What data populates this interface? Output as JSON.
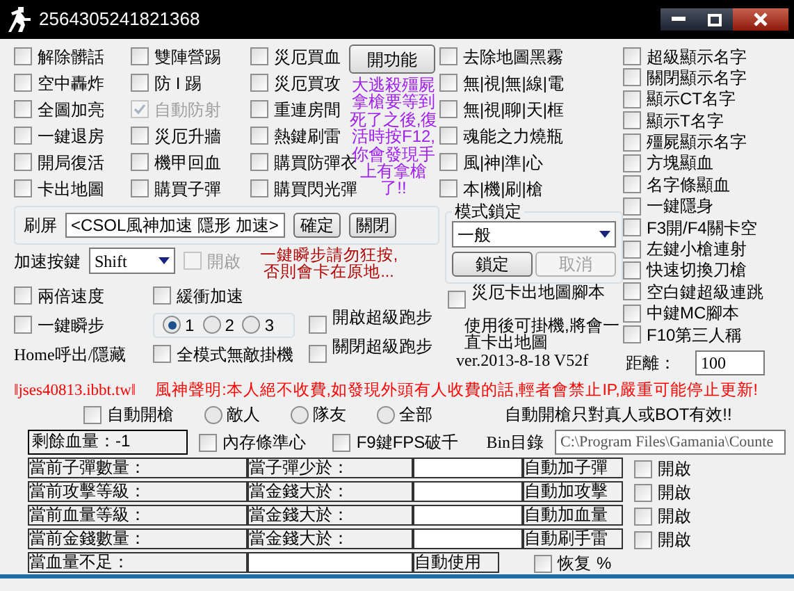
{
  "window": {
    "title": "2564305241821368"
  },
  "feature_columns": [
    [
      {
        "label": "解除髒話",
        "checked": false,
        "disabled": false
      },
      {
        "label": "空中轟炸",
        "checked": false,
        "disabled": false
      },
      {
        "label": "全圖加亮",
        "checked": false,
        "disabled": false
      },
      {
        "label": "一鍵退房",
        "checked": false,
        "disabled": false
      },
      {
        "label": "開局復活",
        "checked": false,
        "disabled": false
      },
      {
        "label": "卡出地圖",
        "checked": false,
        "disabled": false
      }
    ],
    [
      {
        "label": "雙陣營踢",
        "checked": false,
        "disabled": false
      },
      {
        "label": "防 I 踢",
        "checked": false,
        "disabled": false
      },
      {
        "label": "自動防射",
        "checked": true,
        "disabled": true
      },
      {
        "label": "災厄升牆",
        "checked": false,
        "disabled": false
      },
      {
        "label": "機甲回血",
        "checked": false,
        "disabled": false
      },
      {
        "label": "購買子彈",
        "checked": false,
        "disabled": false
      }
    ],
    [
      {
        "label": "災厄買血",
        "checked": false,
        "disabled": false
      },
      {
        "label": "災厄買攻",
        "checked": false,
        "disabled": false
      },
      {
        "label": "重連房間",
        "checked": false,
        "disabled": false
      },
      {
        "label": "熱鍵刷雷",
        "checked": false,
        "disabled": false
      },
      {
        "label": "購買防彈衣",
        "checked": false,
        "disabled": false
      },
      {
        "label": "購買閃光彈",
        "checked": false,
        "disabled": false
      }
    ]
  ],
  "function_button": "開功能",
  "zombie_note": "大逃殺殭屍拿槍要等到死了之後,復活時按F12,你會發現手上有拿槍了!!",
  "map_checks": [
    {
      "label": "去除地圖黑霧",
      "checked": false
    },
    {
      "label": "無|視|無|線|電",
      "checked": false
    },
    {
      "label": "無|視|聊|天|框",
      "checked": false
    },
    {
      "label": "魂能之力燒瓶",
      "checked": false
    },
    {
      "label": "風|神|準|心",
      "checked": false
    },
    {
      "label": "本|機|刷|槍",
      "checked": false
    }
  ],
  "display_checks": [
    {
      "label": "超級顯示名字",
      "checked": false
    },
    {
      "label": "關閉顯示名字",
      "checked": false
    },
    {
      "label": "顯示CT名字",
      "checked": false
    },
    {
      "label": "顯示T名字",
      "checked": false
    },
    {
      "label": "殭屍顯示名字",
      "checked": false
    },
    {
      "label": "方塊顯血",
      "checked": false
    },
    {
      "label": "名字條顯血",
      "checked": false
    },
    {
      "label": "一鍵隱身",
      "checked": false
    },
    {
      "label": "F3開/F4關卡空",
      "checked": false
    },
    {
      "label": "左鍵小槍連射",
      "checked": false
    },
    {
      "label": "快速切換刀槍",
      "checked": false
    },
    {
      "label": "空白鍵超級連跳",
      "checked": false
    },
    {
      "label": "中鍵MC腳本",
      "checked": false
    },
    {
      "label": "F10第三人稱",
      "checked": false
    }
  ],
  "distance": {
    "label": "距離：",
    "value": "100"
  },
  "spam": {
    "label": "刷屏",
    "value": "<CSOL風神加速 隱形 加速>",
    "buttons": [
      {
        "label": "確定",
        "disabled": false
      },
      {
        "label": "關閉",
        "disabled": false
      }
    ]
  },
  "mode_lock": {
    "title": "模式鎖定",
    "value": "一般",
    "buttons": [
      {
        "label": "鎖定",
        "disabled": false
      },
      {
        "label": "取消",
        "disabled": true
      }
    ]
  },
  "speed_key": {
    "label": "加速按鍵",
    "value": "Shift",
    "enable": {
      "label": "開啟",
      "checked": false,
      "disabled": true
    },
    "warning": "一鍵瞬步請勿狂按,否則會卡在原地..."
  },
  "double_speed": {
    "label": "兩倍速度",
    "checked": false
  },
  "buffer_speed": {
    "label": "緩衝加速",
    "checked": false
  },
  "one_key_step": {
    "label": "一鍵瞬步",
    "checked": false
  },
  "step_levels": [
    {
      "label": "1",
      "selected": true
    },
    {
      "label": "2",
      "selected": false
    },
    {
      "label": "3",
      "selected": false
    }
  ],
  "run_on": {
    "label": "開啟超級跑步",
    "checked": false
  },
  "run_off": {
    "label": "關閉超級跑步",
    "checked": false
  },
  "home_hint": "Home呼出/隱藏",
  "invincible": {
    "label": "全模式無敵掛機",
    "checked": false
  },
  "stuck_script": {
    "label": "災厄卡出地圖腳本",
    "checked": false
  },
  "stuck_note": "使用後可掛機,將會一直卡出地圖",
  "version": "ver.2013-8-18 V52f",
  "site": "‖jses40813.ibbt.tw‖",
  "notice": "風神聲明:本人絕不收費,如發現外頭有人收費的話,輕者會禁止IP,嚴重可能停止更新!",
  "auto_fire": {
    "label": "自動開槍",
    "checked": false
  },
  "targets": [
    {
      "label": "敵人",
      "selected": false
    },
    {
      "label": "隊友",
      "selected": false
    },
    {
      "label": "全部",
      "selected": false
    }
  ],
  "auto_fire_note": "自動開槍只對真人或BOT有效!!",
  "remaining_hp": "剩餘血量：-1",
  "memory_crosshair": {
    "label": "內存條準心",
    "checked": false
  },
  "fps": {
    "label": "F9鍵FPS破千",
    "checked": false
  },
  "bin": {
    "label": "Bin目錄",
    "value": "C:\\Program Files\\Gamania\\Counte"
  },
  "auto_rows": [
    {
      "status": "當前子彈數量：",
      "condition": "當子彈少於：",
      "action": "自動加子彈",
      "enable": {
        "label": "開啟",
        "checked": false
      }
    },
    {
      "status": "當前攻擊等級：",
      "condition": "當金錢大於：",
      "action": "自動加攻擊",
      "enable": {
        "label": "開啟",
        "checked": false
      }
    },
    {
      "status": "當前血量等級：",
      "condition": "當金錢大於：",
      "action": "自動加血量",
      "enable": {
        "label": "開啟",
        "checked": false
      }
    },
    {
      "status": "當前金錢數量：",
      "condition": "當金錢大於：",
      "action": "自動刷手雷",
      "enable": {
        "label": "開啟",
        "checked": false
      }
    }
  ],
  "low_hp": {
    "label": "當血量不足：",
    "action": "自動使用",
    "restore": {
      "label": "恢复",
      "checked": false
    },
    "unit": "%"
  }
}
